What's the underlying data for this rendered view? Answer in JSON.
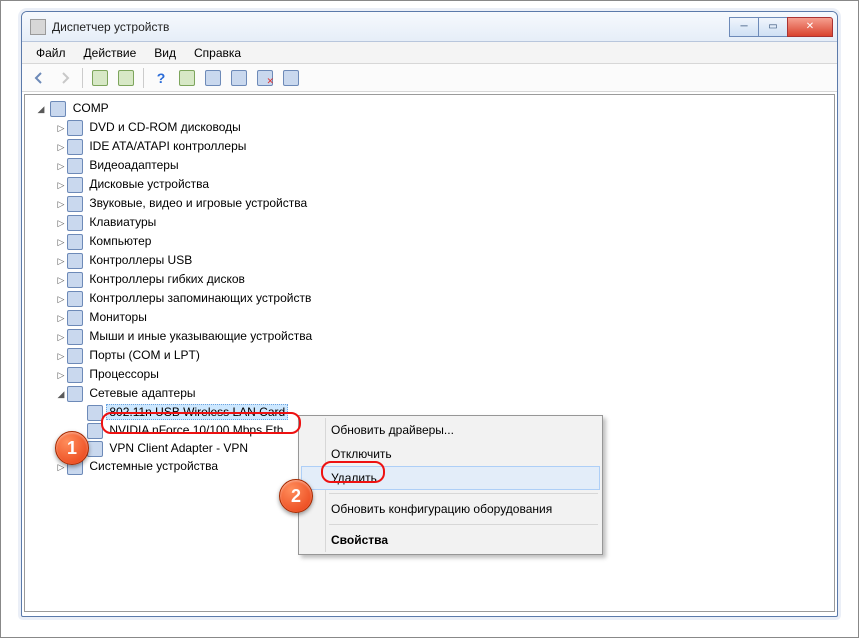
{
  "window": {
    "title": "Диспетчер устройств"
  },
  "menu": {
    "file": "Файл",
    "action": "Действие",
    "view": "Вид",
    "help": "Справка"
  },
  "tree": {
    "root": "COMP",
    "items": [
      "DVD и CD-ROM дисководы",
      "IDE ATA/ATAPI контроллеры",
      "Видеоадаптеры",
      "Дисковые устройства",
      "Звуковые, видео и игровые устройства",
      "Клавиатуры",
      "Компьютер",
      "Контроллеры USB",
      "Контроллеры гибких дисков",
      "Контроллеры запоминающих устройств",
      "Мониторы",
      "Мыши и иные указывающие устройства",
      "Порты (COM и LPT)",
      "Процессоры"
    ],
    "network_adapters_label": "Сетевые адаптеры",
    "network_adapters": {
      "selected": "802.11n USB Wireless LAN Card",
      "item2": "NVIDIA nForce 10/100 Mbps Eth",
      "item3": "VPN Client Adapter - VPN"
    },
    "system_devices": "Системные устройства"
  },
  "context_menu": {
    "update": "Обновить драйверы...",
    "disable": "Отключить",
    "delete": "Удалить",
    "rescan": "Обновить конфигурацию оборудования",
    "properties": "Свойства"
  },
  "callouts": {
    "one": "1",
    "two": "2"
  }
}
